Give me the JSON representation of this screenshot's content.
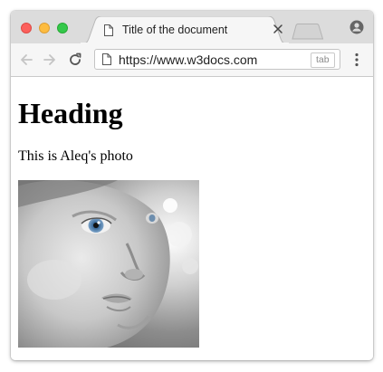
{
  "browser": {
    "tab": {
      "title": "Title of the document",
      "doc_icon": "document-icon",
      "close_icon": "close-icon"
    },
    "new_tab_icon": "new-tab-icon",
    "profile_icon": "profile-icon",
    "toolbar": {
      "back_icon": "arrow-left-icon",
      "forward_icon": "arrow-right-icon",
      "reload_icon": "reload-icon",
      "menu_icon": "vertical-dots-icon"
    },
    "omnibox": {
      "url": "https://www.w3docs.com",
      "hint": "tab"
    },
    "colors": {
      "close": "#fc605c",
      "minimize": "#fdbc40",
      "maximize": "#34c84a",
      "titlebar": "#dcdcdc",
      "toolbar": "#f6f6f6"
    }
  },
  "page": {
    "heading": "Heading",
    "paragraph": "This is Aleq's photo",
    "image_subject": "grayscale close-up photo of a baby with blue eyes"
  }
}
